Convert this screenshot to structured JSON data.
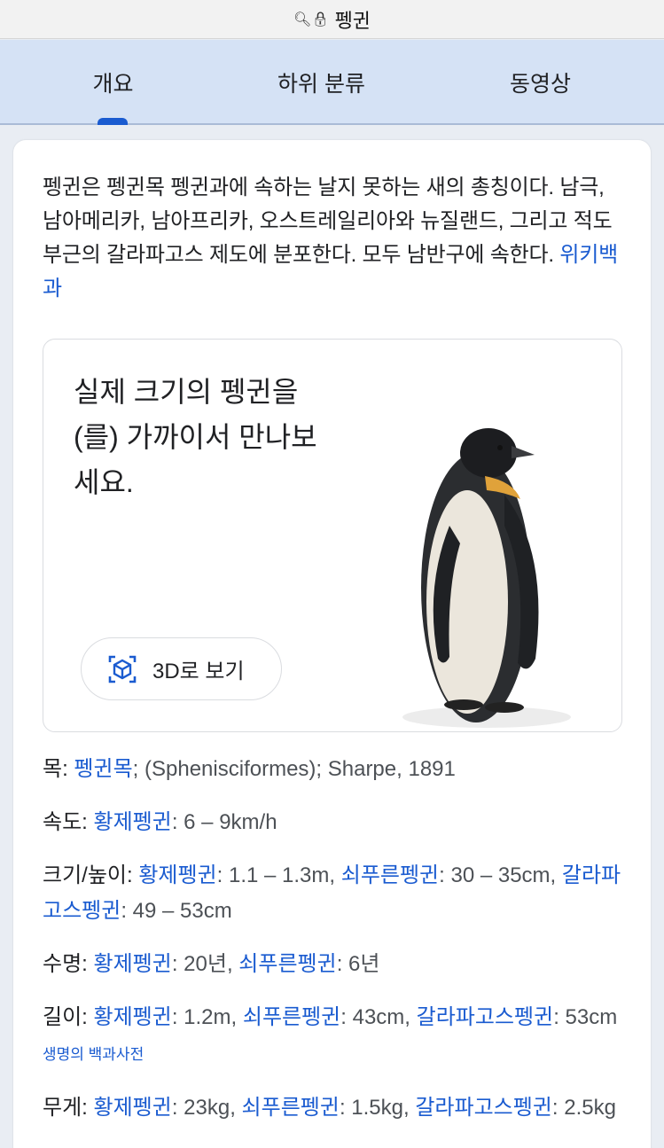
{
  "urlbar": {
    "title": "펭귄"
  },
  "tabs": [
    {
      "label": "개요"
    },
    {
      "label": "하위 분류"
    },
    {
      "label": "동영상"
    }
  ],
  "summary": {
    "text": "펭귄은 펭귄목 펭귄과에 속하는 날지 못하는 새의 총칭이다. 남극, 남아메리카, 남아프리카, 오스트레일리아와 뉴질랜드, 그리고 적도 부근의 갈라파고스 제도에 분포한다. 모두 남반구에 속한다. ",
    "source": "위키백과"
  },
  "promo": {
    "title": "실제 크기의 펭귄을(를) 가까이서 만나보세요.",
    "button": "3D로 보기"
  },
  "facts": {
    "order": {
      "label": "목:",
      "link": "펭귄목",
      "rest": "; (Sphenisciformes); Sharpe, 1891"
    },
    "speed": {
      "label": "속도:",
      "link1": "황제펭귄",
      "val1": ": 6 – 9km/h"
    },
    "size": {
      "label": "크기/높이:",
      "link1": "황제펭귄",
      "val1": ": 1.1 – 1.3m, ",
      "link2": "쇠푸른펭귄",
      "val2": ": 30 – 35cm, ",
      "link3": "갈라파고스펭귄",
      "val3": ": 49 – 53cm"
    },
    "lifespan": {
      "label": "수명:",
      "link1": "황제펭귄",
      "val1": ": 20년, ",
      "link2": "쇠푸른펭귄",
      "val2": ": 6년"
    },
    "length": {
      "label": "길이:",
      "link1": "황제펭귄",
      "val1": ": 1.2m, ",
      "link2": "쇠푸른펭귄",
      "val2": ": 43cm, ",
      "link3": "갈라파고스펭귄",
      "val3": ": 53cm ",
      "source": "생명의 백과사전"
    },
    "weight": {
      "label": "무게:",
      "link1": "황제펭귄",
      "val1": ": 23kg, ",
      "link2": "쇠푸른펭귄",
      "val2": ": 1.5kg, ",
      "link3": "갈라파고스펭귄",
      "val3": ": 2.5kg"
    }
  },
  "colors": {
    "link": "#1a5bd0",
    "tabbar": "#d5e2f5",
    "page": "#e9edf3"
  }
}
